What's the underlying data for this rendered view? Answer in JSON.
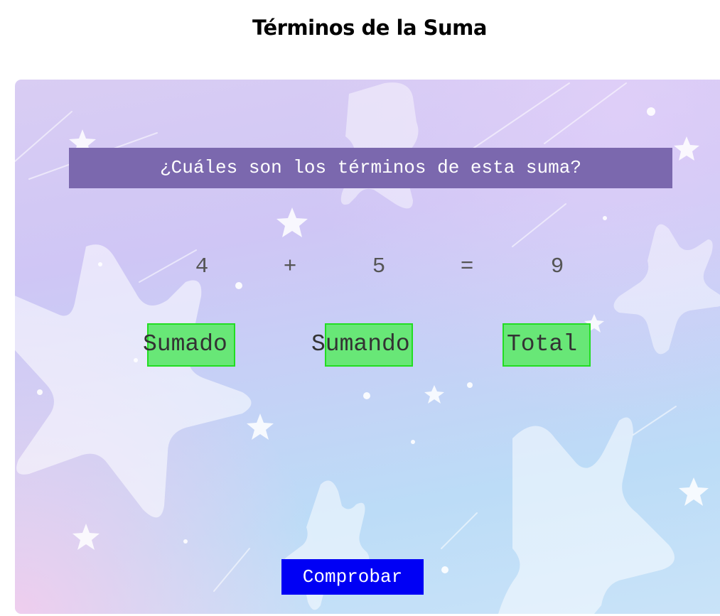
{
  "title": "Términos de la Suma",
  "question": "¿Cuáles son los términos de esta suma?",
  "equation": {
    "a": "4",
    "plus": "+",
    "b": "5",
    "equals": "=",
    "result": "9"
  },
  "words": [
    "Sumado",
    "Sumando",
    "Total"
  ],
  "check_label": "Comprobar",
  "colors": {
    "question_bg": "#7b68ae",
    "word_box": "#68e777",
    "word_border": "#22dd22",
    "button_bg": "#0000f5"
  }
}
